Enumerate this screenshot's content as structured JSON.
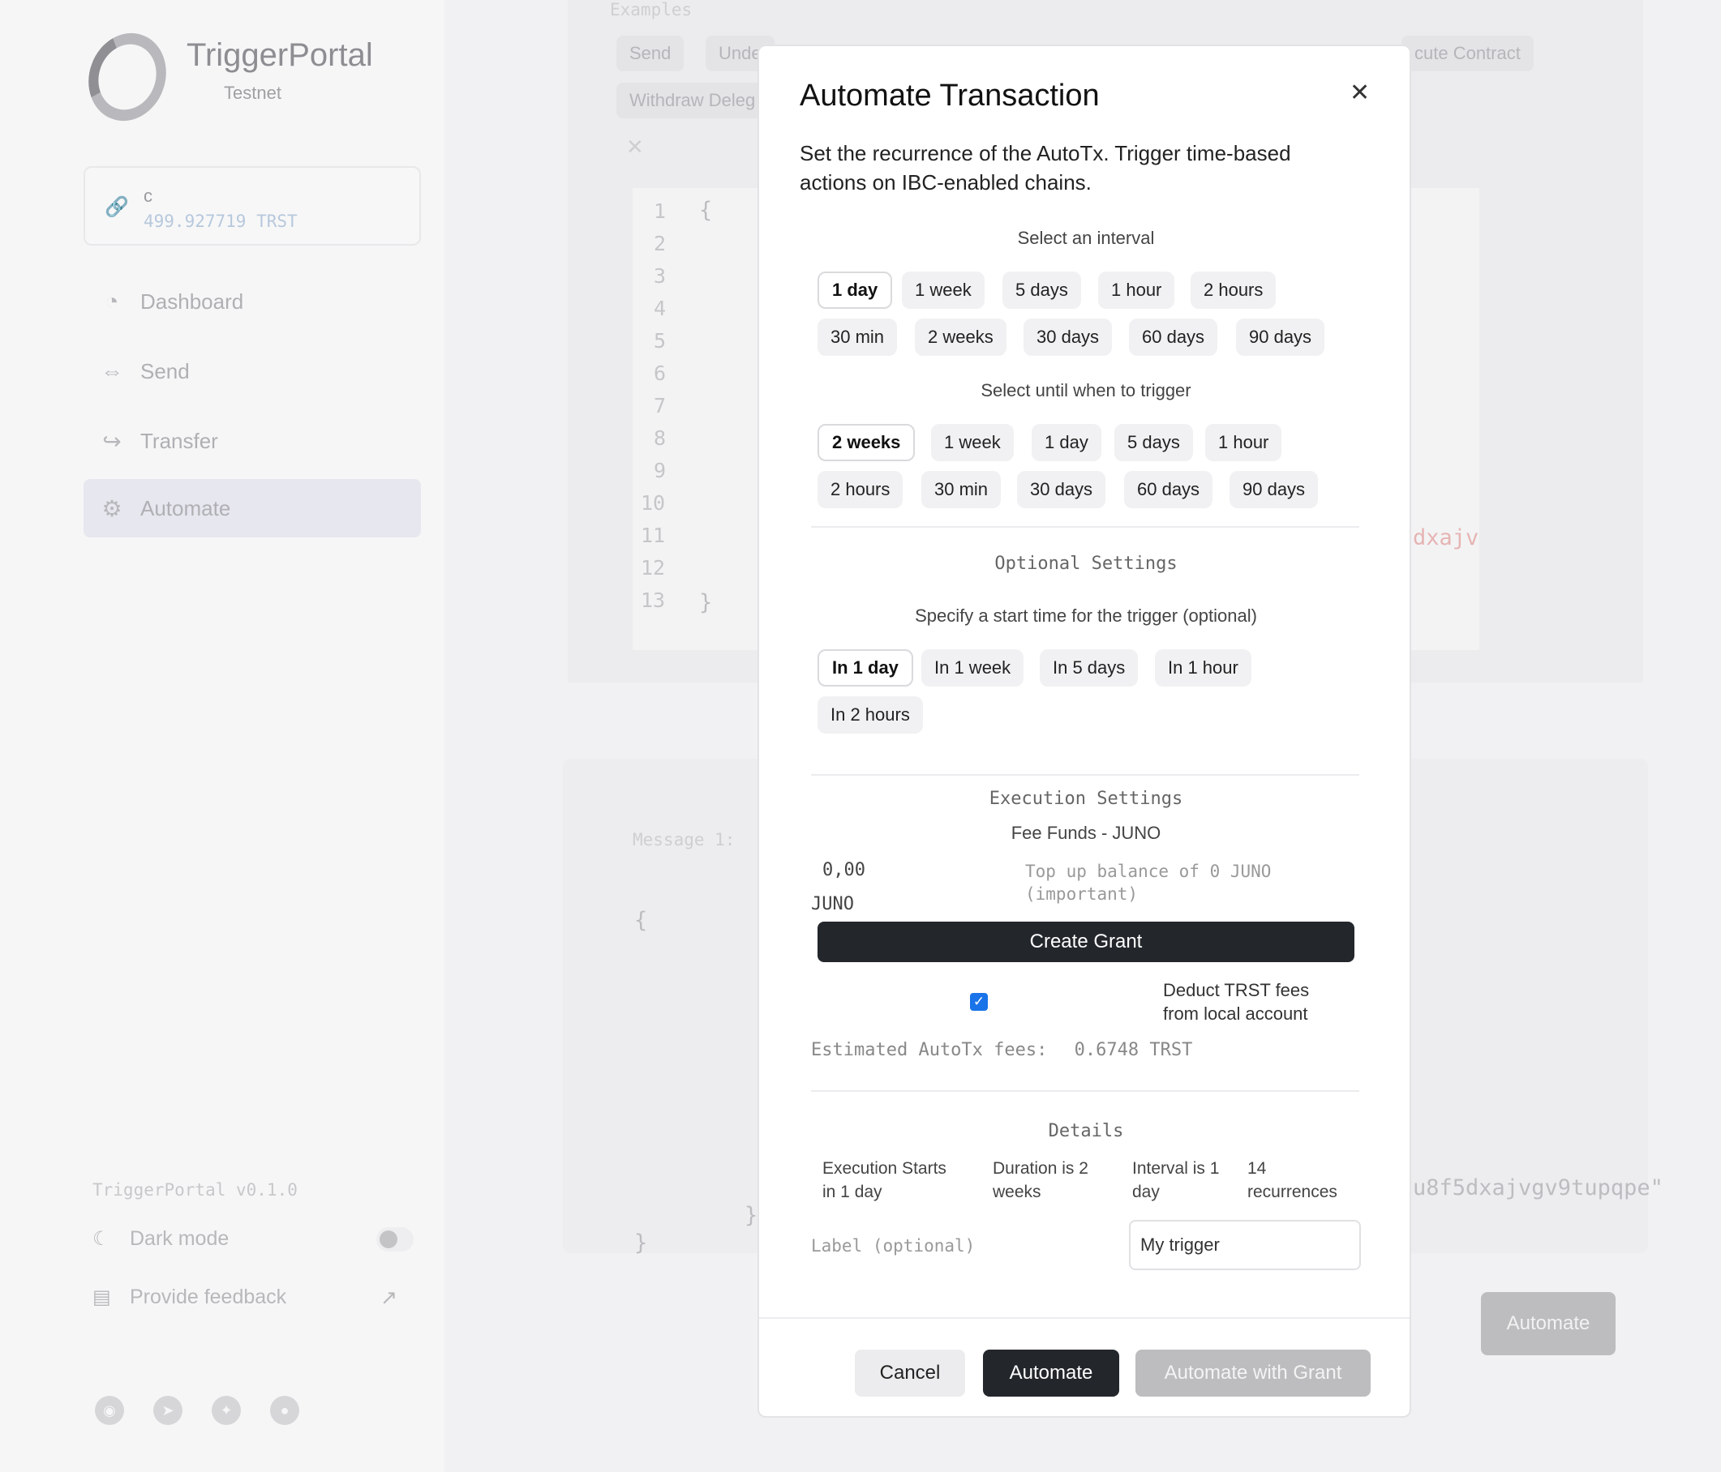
{
  "app": {
    "name": "TriggerPortal",
    "network": "Testnet",
    "version": "TriggerPortal v0.1.0"
  },
  "wallet": {
    "name": "c",
    "balance": "499.927719 TRST"
  },
  "nav": [
    {
      "label": "Dashboard",
      "icon": "dashboard-icon"
    },
    {
      "label": "Send",
      "icon": "arrows-icon"
    },
    {
      "label": "Transfer",
      "icon": "share-arrow-icon"
    },
    {
      "label": "Automate",
      "icon": "gear-icon",
      "active": true
    }
  ],
  "sidebar_bottom": {
    "dark_mode": "Dark mode",
    "feedback": "Provide feedback"
  },
  "background": {
    "examples_label": "Examples",
    "example_chips": [
      "Send",
      "Unde",
      "cute Contract",
      "Withdraw Deleg"
    ],
    "line_numbers": [
      "1",
      "2",
      "3",
      "4",
      "5",
      "6",
      "7",
      "8",
      "9",
      "10",
      "11",
      "12",
      "13"
    ],
    "code_open": "{",
    "code_close": "}",
    "code_fragment": "dxajv",
    "message_label": "Message 1:",
    "msg_open": "{",
    "msg_close": "}",
    "msg_inner_close": "}",
    "msg_fragment": "u8f5dxajvgv9tupqpe\"",
    "automate_button": "Automate"
  },
  "modal": {
    "title": "Automate Transaction",
    "description": "Set the recurrence of the AutoTx. Trigger time-based actions on IBC-enabled chains.",
    "interval": {
      "title": "Select an interval",
      "options": [
        "1 day",
        "1 week",
        "5 days",
        "1 hour",
        "2 hours",
        "30 min",
        "2 weeks",
        "30 days",
        "60 days",
        "90 days"
      ],
      "selected": "1 day"
    },
    "until": {
      "title": "Select until when to trigger",
      "options": [
        "2 weeks",
        "1 week",
        "1 day",
        "5 days",
        "1 hour",
        "2 hours",
        "30 min",
        "30 days",
        "60 days",
        "90 days"
      ],
      "selected": "2 weeks"
    },
    "optional": {
      "title": "Optional Settings",
      "start_title": "Specify a start time for the trigger (optional)",
      "options": [
        "In 1 day",
        "In 1 week",
        "In 5 days",
        "In 1 hour",
        "In 2 hours"
      ],
      "selected": "In 1 day"
    },
    "execution": {
      "title": "Execution Settings",
      "fee_title": "Fee Funds - JUNO",
      "fee_value": "0,00",
      "fee_unit": "JUNO",
      "fee_note": "Top up balance of 0 JUNO (important)",
      "create_grant": "Create Grant",
      "deduct_checked": true,
      "deduct_label": "Deduct TRST fees from local account",
      "estimated_label": "Estimated AutoTx fees:",
      "estimated_value": "0.6748 TRST"
    },
    "details": {
      "title": "Details",
      "items": [
        "Execution Starts in 1 day",
        "Duration is 2 weeks",
        "Interval is 1 day",
        "14 recurrences"
      ],
      "label_text": "Label  (optional)",
      "label_value": "My trigger"
    },
    "footer": {
      "cancel": "Cancel",
      "automate": "Automate",
      "automate_grant": "Automate with Grant"
    },
    "colors": {
      "primary": "#23262b",
      "disabled": "#bdbdbf",
      "checkbox": "#1a73e8"
    }
  }
}
